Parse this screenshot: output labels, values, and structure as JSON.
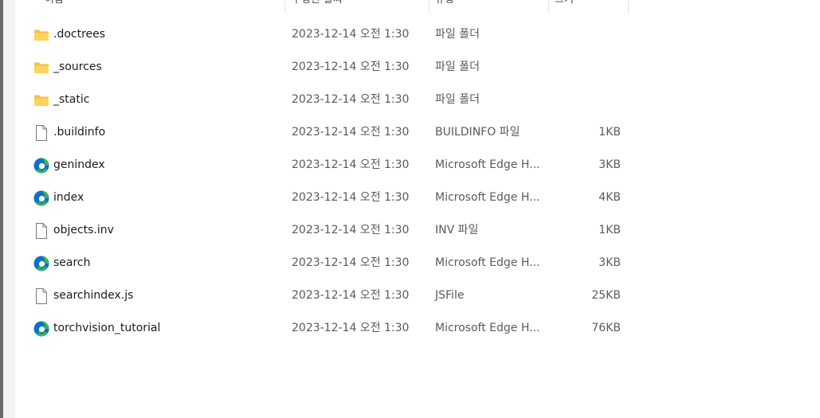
{
  "columns": {
    "name": "이름",
    "date": "수정한 날짜",
    "type": "유형",
    "size": "크기"
  },
  "files": [
    {
      "name": ".doctrees",
      "date": "2023-12-14 오전 1:30",
      "type": "파일 폴더",
      "size": "",
      "icon": "folder-icon"
    },
    {
      "name": "_sources",
      "date": "2023-12-14 오전 1:30",
      "type": "파일 폴더",
      "size": "",
      "icon": "folder-icon"
    },
    {
      "name": "_static",
      "date": "2023-12-14 오전 1:30",
      "type": "파일 폴더",
      "size": "",
      "icon": "folder-icon"
    },
    {
      "name": ".buildinfo",
      "date": "2023-12-14 오전 1:30",
      "type": "BUILDINFO 파일",
      "size": "1KB",
      "icon": "file-icon"
    },
    {
      "name": "genindex",
      "date": "2023-12-14 오전 1:30",
      "type": "Microsoft Edge H...",
      "size": "3KB",
      "icon": "edge-icon"
    },
    {
      "name": "index",
      "date": "2023-12-14 오전 1:30",
      "type": "Microsoft Edge H...",
      "size": "4KB",
      "icon": "edge-icon"
    },
    {
      "name": "objects.inv",
      "date": "2023-12-14 오전 1:30",
      "type": "INV 파일",
      "size": "1KB",
      "icon": "file-icon"
    },
    {
      "name": "search",
      "date": "2023-12-14 오전 1:30",
      "type": "Microsoft Edge H...",
      "size": "3KB",
      "icon": "edge-icon"
    },
    {
      "name": "searchindex.js",
      "date": "2023-12-14 오전 1:30",
      "type": "JSFile",
      "size": "25KB",
      "icon": "file-icon"
    },
    {
      "name": "torchvision_tutorial",
      "date": "2023-12-14 오전 1:30",
      "type": "Microsoft Edge H...",
      "size": "76KB",
      "icon": "edge-icon"
    }
  ],
  "colors": {
    "folder": "#f4c04a",
    "edge_blue": "#0c6fd1",
    "edge_green": "#3bb54a"
  }
}
